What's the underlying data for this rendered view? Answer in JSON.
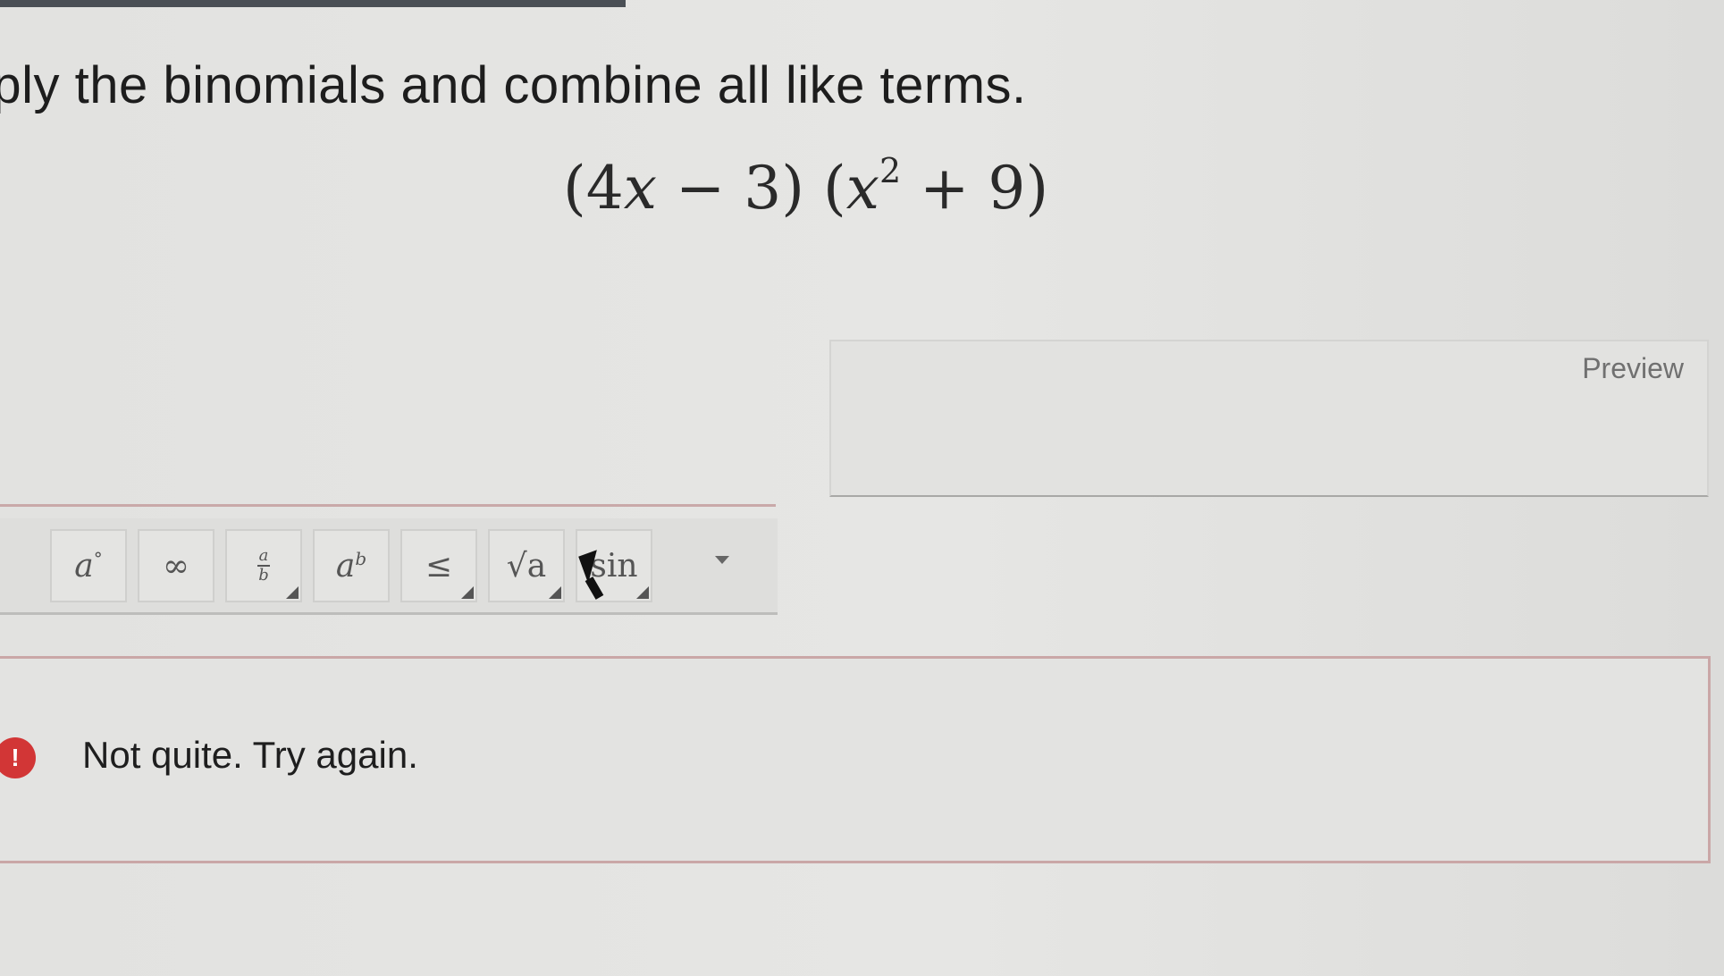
{
  "question": {
    "instruction": "iply the binomials and combine all like terms.",
    "expression": {
      "open1": "(",
      "coef": "4",
      "var1": "x",
      "minus": " − ",
      "const1": "3",
      "close1": ")",
      "open2": " (",
      "var2": "x",
      "exp": "2",
      "plus": " + ",
      "const2": "9",
      "close2": ")"
    }
  },
  "preview": {
    "label": "Preview"
  },
  "toolbar": {
    "buttons": [
      {
        "name": "degree",
        "base": "a",
        "sup": "°"
      },
      {
        "name": "infinity",
        "label": "∞"
      },
      {
        "name": "fraction",
        "num": "a",
        "den": "b"
      },
      {
        "name": "power",
        "base": "a",
        "sup": "b"
      },
      {
        "name": "less-equal",
        "label": "≤"
      },
      {
        "name": "sqrt",
        "label": "√a"
      },
      {
        "name": "sin",
        "label": "sin"
      }
    ]
  },
  "feedback": {
    "icon": "!",
    "message": "Not quite. Try again."
  },
  "colors": {
    "error": "#d23636",
    "feedback_border": "#caa7a7"
  }
}
